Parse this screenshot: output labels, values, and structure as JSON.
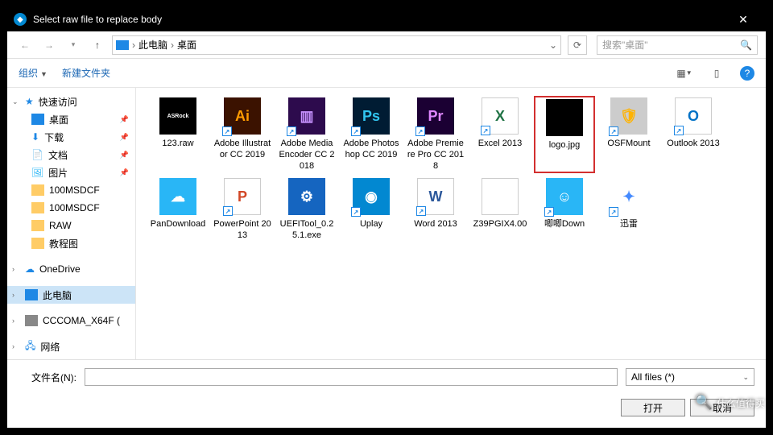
{
  "title": "Select raw file to replace body",
  "breadcrumb": {
    "root": "此电脑",
    "current": "桌面"
  },
  "search_placeholder": "搜索\"桌面\"",
  "toolbar": {
    "organize": "组织",
    "newfolder": "新建文件夹"
  },
  "sidebar": {
    "quickaccess": "快速访问",
    "items": [
      {
        "label": "桌面",
        "pin": true
      },
      {
        "label": "下载",
        "pin": true
      },
      {
        "label": "文档",
        "pin": true
      },
      {
        "label": "图片",
        "pin": true
      },
      {
        "label": "100MSDCF"
      },
      {
        "label": "100MSDCF"
      },
      {
        "label": "RAW"
      },
      {
        "label": "教程图"
      }
    ],
    "onedrive": "OneDrive",
    "thispc": "此电脑",
    "drive": "CCCOMA_X64F (",
    "network": "网络"
  },
  "files": [
    {
      "label": "123.raw",
      "bg": "#000",
      "text": "ASRock",
      "fs": "7"
    },
    {
      "label": "Adobe Illustrator CC 2019",
      "bg": "#3b1200",
      "text": "Ai",
      "fg": "#ff9a00",
      "sc": true
    },
    {
      "label": "Adobe Media Encoder CC 2018",
      "bg": "#2d0b4d",
      "text": "▥",
      "fg": "#c792ff",
      "sc": true
    },
    {
      "label": "Adobe Photoshop CC 2019",
      "bg": "#001c33",
      "text": "Ps",
      "fg": "#31c5f0",
      "sc": true
    },
    {
      "label": "Adobe Premiere Pro CC 2018",
      "bg": "#1b0033",
      "text": "Pr",
      "fg": "#e087ff",
      "sc": true
    },
    {
      "label": "Excel 2013",
      "bg": "#fff",
      "text": "X",
      "fg": "#1f7244",
      "sc": true,
      "border": true
    },
    {
      "label": "logo.jpg",
      "bg": "#000",
      "text": "",
      "selected": true
    },
    {
      "label": "OSFMount",
      "bg": "#ccc",
      "text": "🛡",
      "fg": "#ffb300",
      "sc": true
    },
    {
      "label": "Outlook 2013",
      "bg": "#fff",
      "text": "O",
      "fg": "#0072c6",
      "sc": true,
      "border": true
    },
    {
      "label": "PanDownload",
      "bg": "#29b6f6",
      "text": "☁",
      "fg": "#fff"
    },
    {
      "label": "PowerPoint 2013",
      "bg": "#fff",
      "text": "P",
      "fg": "#d24726",
      "sc": true,
      "border": true
    },
    {
      "label": "UEFITool_0.25.1.exe",
      "bg": "#1565c0",
      "text": "⚙",
      "fg": "#fff"
    },
    {
      "label": "Uplay",
      "bg": "#0288d1",
      "text": "◉",
      "fg": "#fff",
      "sc": true
    },
    {
      "label": "Word 2013",
      "bg": "#fff",
      "text": "W",
      "fg": "#2b579a",
      "sc": true,
      "border": true
    },
    {
      "label": "Z39PGIX4.00",
      "bg": "#fff",
      "text": "",
      "border": true
    },
    {
      "label": "唧唧Down",
      "bg": "#29b6f6",
      "text": "☺",
      "fg": "#fff",
      "sc": true
    },
    {
      "label": "迅雷",
      "bg": "#fff",
      "text": "✦",
      "fg": "#448aff",
      "sc": true
    }
  ],
  "bottom": {
    "fnlabel": "文件名(N):",
    "filter": "All files  (*)",
    "open": "打开",
    "cancel": "取消"
  },
  "watermark": "什么值得买"
}
